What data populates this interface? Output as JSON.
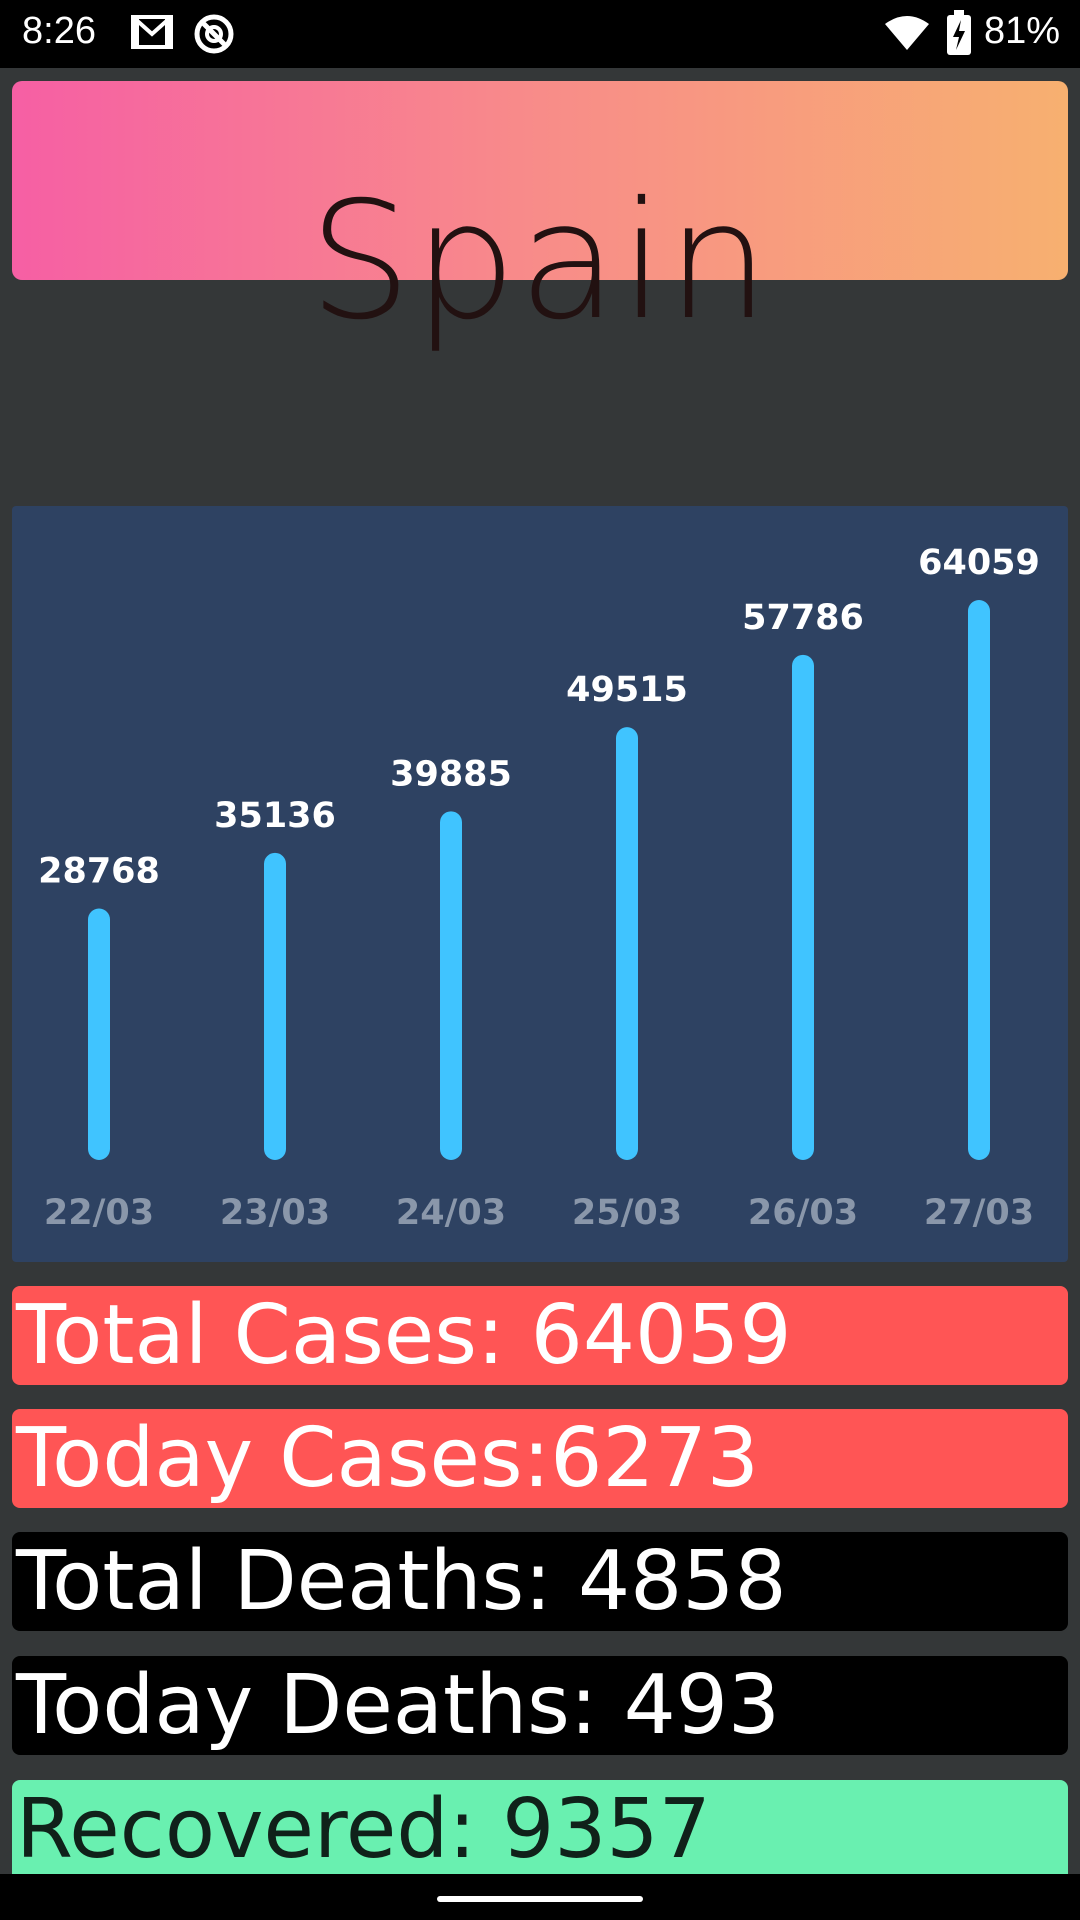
{
  "status_bar": {
    "time": "8:26",
    "battery_percent": "81%",
    "icons": [
      "gmail-icon",
      "circle-a-icon",
      "wifi-icon",
      "battery-charging-icon"
    ]
  },
  "header": {
    "title": "Spain",
    "gradient": [
      "#f65fa4",
      "#f88c89",
      "#f7b070"
    ]
  },
  "chart_data": {
    "type": "bar",
    "categories": [
      "22/03",
      "23/03",
      "24/03",
      "25/03",
      "26/03",
      "27/03"
    ],
    "values": [
      28768,
      35136,
      39885,
      49515,
      57786,
      64059
    ],
    "title": "",
    "xlabel": "",
    "ylabel": "",
    "ylim": [
      0,
      64059
    ],
    "grid": false,
    "bar_color": "#40c4ff",
    "background": "#2e4262"
  },
  "stats": {
    "total_cases": "Total Cases: 64059",
    "today_cases": "Today Cases:6273",
    "total_deaths": "Total Deaths: 4858",
    "today_deaths": "Today Deaths: 493",
    "recovered": "Recovered: 9357"
  },
  "colors": {
    "cases": "#ff5555",
    "deaths": "#000000",
    "recovered": "#69f0b0"
  }
}
